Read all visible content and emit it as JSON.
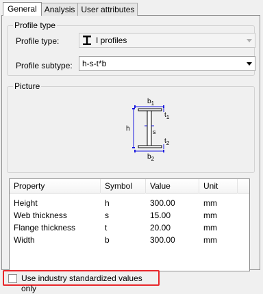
{
  "tabs": [
    "General",
    "Analysis",
    "User attributes"
  ],
  "profile_type_group": {
    "title": "Profile type",
    "type_label": "Profile type:",
    "type_value": "I profiles",
    "subtype_label": "Profile subtype:",
    "subtype_value": "h-s-t*b"
  },
  "picture_group": {
    "title": "Picture",
    "labels": {
      "b1_main": "b",
      "b1_sub": "1",
      "t1_main": "t",
      "t1_sub": "1",
      "h": "h",
      "s": "s",
      "t2_main": "t",
      "t2_sub": "2",
      "b2_main": "b",
      "b2_sub": "2"
    }
  },
  "table": {
    "headers": [
      "Property",
      "Symbol",
      "Value",
      "Unit"
    ],
    "rows": [
      [
        "Height",
        "h",
        "300.00",
        "mm"
      ],
      [
        "Web thickness",
        "s",
        "15.00",
        "mm"
      ],
      [
        "Flange thickness",
        "t",
        "20.00",
        "mm"
      ],
      [
        "Width",
        "b",
        "300.00",
        "mm"
      ]
    ]
  },
  "checkbox": {
    "label": "Use industry standardized values only",
    "checked": false
  },
  "colors": {
    "highlight": "#e8262a",
    "dimension": "#1a1adf"
  },
  "icons": {
    "profile_type": "i-beam-icon"
  }
}
